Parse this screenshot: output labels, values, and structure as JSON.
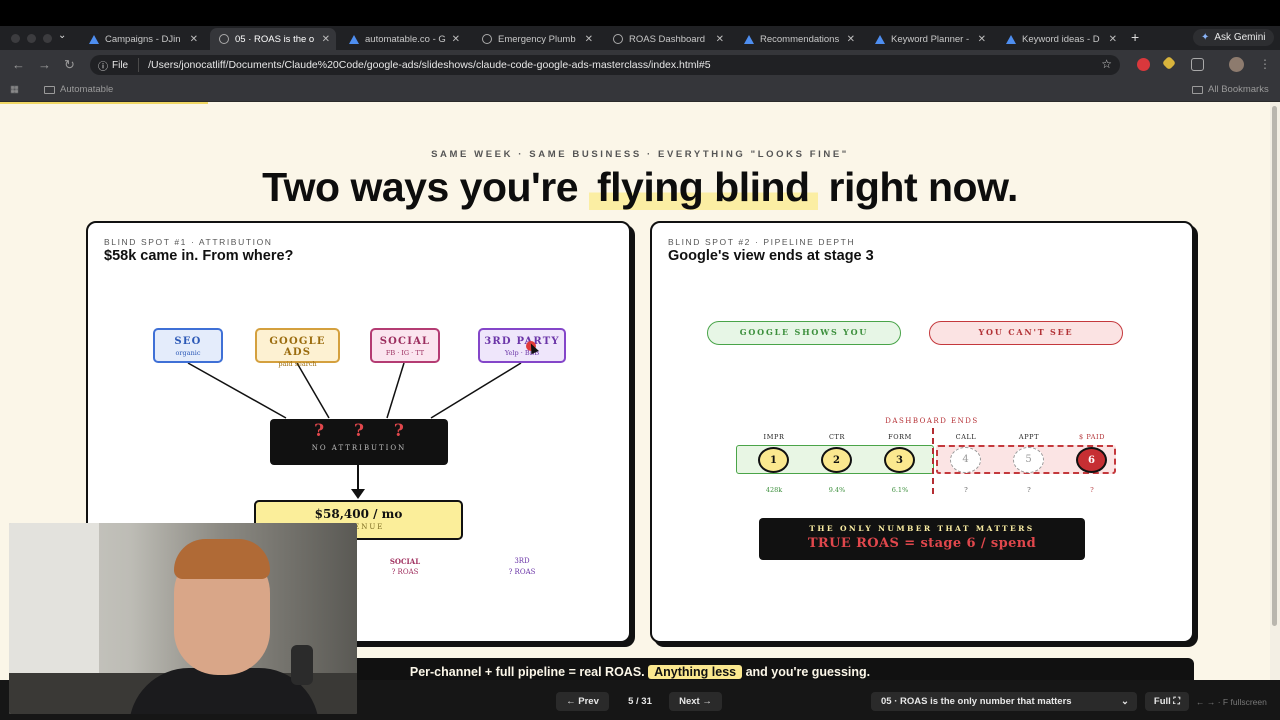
{
  "browser": {
    "tabs": [
      {
        "label": "Campaigns - DJin",
        "icon": "google-ads-icon",
        "active": false
      },
      {
        "label": "05 · ROAS is the o",
        "icon": "globe-icon",
        "active": true
      },
      {
        "label": "automatable.co - G",
        "icon": "google-ads-icon",
        "active": false
      },
      {
        "label": "Emergency Plumb",
        "icon": "globe-icon",
        "active": false
      },
      {
        "label": "ROAS Dashboard",
        "icon": "globe-icon",
        "active": false
      },
      {
        "label": "Recommendations",
        "icon": "google-ads-icon",
        "active": false
      },
      {
        "label": "Keyword Planner -",
        "icon": "google-ads-icon",
        "active": false
      },
      {
        "label": "Keyword ideas - D",
        "icon": "google-ads-icon",
        "active": false
      }
    ],
    "ask_gemini": "Ask Gemini",
    "file_chip": "File",
    "url": "/Users/jonocatliff/Documents/Claude%20Code/google-ads/slideshows/claude-code-google-ads-masterclass/index.html#5",
    "bookmark_folder": "Automatable",
    "all_bookmarks": "All Bookmarks",
    "accent_color": "#4e8ef0"
  },
  "slide": {
    "kicker": "SAME WEEK · SAME BUSINESS · EVERYTHING \"LOOKS FINE\"",
    "headline_pre": "Two ways you're",
    "headline_highlight": "flying blind",
    "headline_post": "right now.",
    "card1": {
      "kicker": "BLIND SPOT #1 · ATTRIBUTION",
      "title": "$58k came in. From where?",
      "sources": [
        {
          "name": "SEO",
          "sub": "organic"
        },
        {
          "name": "GOOGLE ADS",
          "sub": "paid search"
        },
        {
          "name": "SOCIAL",
          "sub": "FB · IG · TT"
        },
        {
          "name": "3RD PARTY",
          "sub": "Yelp · BBB"
        }
      ],
      "unknown_marks": "? ? ?",
      "unknown_label": "NO ATTRIBUTION",
      "revenue_value": "$58,400 / mo",
      "revenue_label": "REVENUE",
      "roas_social_name": "SOCIAL",
      "roas_social_value": "? ROAS",
      "roas_third_name": "3RD",
      "roas_third_value": "? ROAS"
    },
    "card2": {
      "kicker": "BLIND SPOT #2 · PIPELINE DEPTH",
      "title": "Google's view ends at stage 3",
      "pill_shows": "GOOGLE SHOWS YOU",
      "pill_cant": "YOU CAN'T SEE",
      "dashboard_ends": "DASHBOARD ENDS",
      "stages": [
        {
          "label": "IMPR",
          "num": "1",
          "value": "428k"
        },
        {
          "label": "CTR",
          "num": "2",
          "value": "9.4%"
        },
        {
          "label": "FORM",
          "num": "3",
          "value": "6.1%"
        },
        {
          "label": "CALL",
          "num": "4",
          "value": "?"
        },
        {
          "label": "APPT",
          "num": "5",
          "value": "?"
        },
        {
          "label": "$ PAID",
          "num": "6",
          "value": "?"
        }
      ],
      "formula_kicker": "THE ONLY NUMBER THAT MATTERS",
      "formula": "TRUE ROAS = stage 6 / spend"
    },
    "banner_pre": "Per-channel + full pipeline = real ROAS.",
    "banner_highlight": "Anything less",
    "banner_post": "and you're guessing."
  },
  "controls": {
    "prev": "← Prev",
    "counter": "5 / 31",
    "next": "Next →",
    "slide_select": "05 · ROAS is the only number that matters",
    "full": "Full ⛶",
    "fullscreen_hint": "← → · F fullscreen"
  }
}
